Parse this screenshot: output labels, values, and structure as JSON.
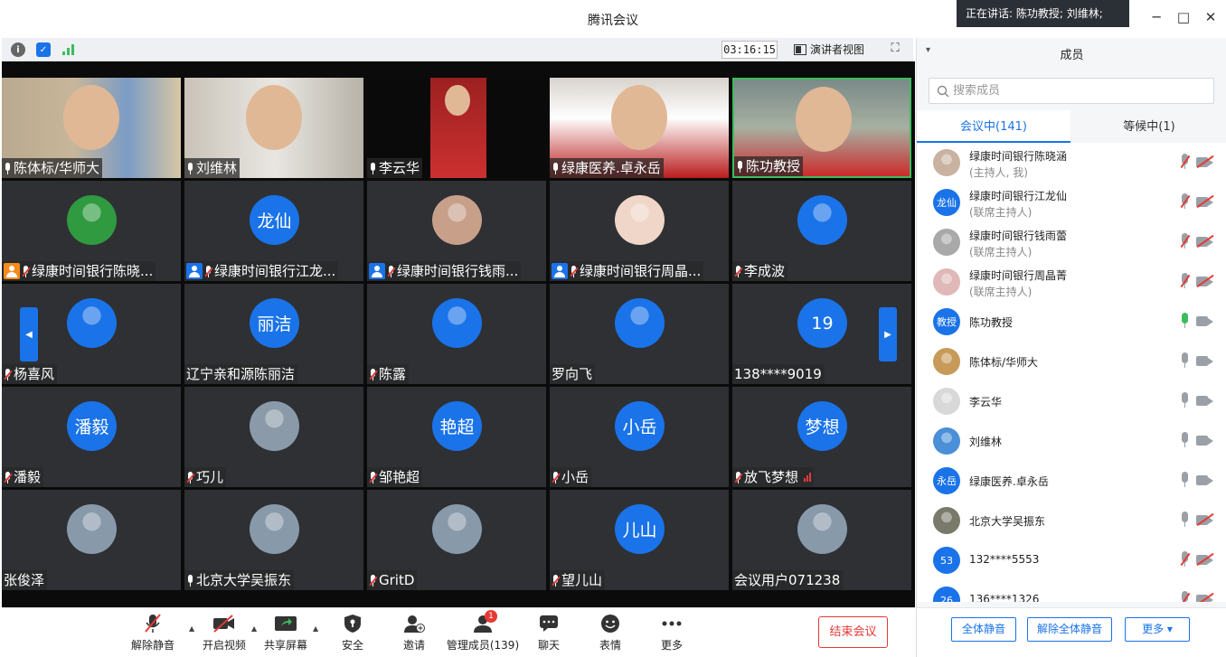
{
  "window": {
    "title": "腾讯会议",
    "speaking": "正在讲话: 陈功教授; 刘维林;",
    "minimize": "─",
    "maximize": "□",
    "close": "✕"
  },
  "topbar": {
    "timer": "03:16:15",
    "view_label": "演讲者视图",
    "icons": [
      "info-icon",
      "shield-icon",
      "signal-icon",
      "fullscreen-icon"
    ]
  },
  "accent": "#1a73e8",
  "grid": [
    {
      "name": "陈体标/华师大",
      "type": "video",
      "mic": "on"
    },
    {
      "name": "刘维林",
      "type": "video",
      "mic": "on"
    },
    {
      "name": "李云华",
      "type": "video",
      "mic": "on"
    },
    {
      "name": "绿康医养.卓永岳",
      "type": "video",
      "mic": "on"
    },
    {
      "name": "陈功教授",
      "type": "video",
      "mic": "on",
      "active": true
    },
    {
      "name": "绿康时间银行陈晓...",
      "type": "photo",
      "mic": "muted",
      "host": "orange"
    },
    {
      "name": "绿康时间银行江龙...",
      "type": "text",
      "avatar": "龙仙",
      "mic": "muted",
      "host": "blue"
    },
    {
      "name": "绿康时间银行钱雨...",
      "type": "photo",
      "mic": "muted",
      "host": "blue"
    },
    {
      "name": "绿康时间银行周晶...",
      "type": "photo",
      "mic": "muted",
      "host": "blue"
    },
    {
      "name": "李成波",
      "type": "photo",
      "mic": "muted"
    },
    {
      "name": "杨喜风",
      "type": "photo",
      "mic": "muted"
    },
    {
      "name": "辽宁亲和源陈丽洁",
      "type": "text",
      "avatar": "丽洁",
      "mic": "none"
    },
    {
      "name": "陈露",
      "type": "photo",
      "mic": "muted"
    },
    {
      "name": "罗向飞",
      "type": "photo",
      "mic": "none"
    },
    {
      "name": "138****9019",
      "type": "text",
      "avatar": "19",
      "mic": "none"
    },
    {
      "name": "潘毅",
      "type": "text",
      "avatar": "潘毅",
      "mic": "muted"
    },
    {
      "name": "巧儿",
      "type": "photo",
      "mic": "muted"
    },
    {
      "name": "邹艳超",
      "type": "text",
      "avatar": "艳超",
      "mic": "muted"
    },
    {
      "name": "小岳",
      "type": "text",
      "avatar": "小岳",
      "mic": "muted"
    },
    {
      "name": "放飞梦想",
      "type": "text",
      "avatar": "梦想",
      "mic": "muted",
      "signal": true
    },
    {
      "name": "张俊泽",
      "type": "photo",
      "mic": "none"
    },
    {
      "name": "北京大学吴振东",
      "type": "photo",
      "mic": "on"
    },
    {
      "name": "GritD",
      "type": "photo",
      "mic": "muted"
    },
    {
      "name": "望儿山",
      "type": "text",
      "avatar": "儿山",
      "mic": "muted"
    },
    {
      "name": "会议用户071238",
      "type": "photo",
      "mic": "none"
    }
  ],
  "toolbar": {
    "unmute": "解除静音",
    "video": "开启视频",
    "share": "共享屏幕",
    "security": "安全",
    "invite": "邀请",
    "manage": "管理成员(139)",
    "manage_badge": "1",
    "chat": "聊天",
    "emoji": "表情",
    "more": "更多",
    "end": "结束会议"
  },
  "panel": {
    "title": "成员",
    "search_placeholder": "搜索成员",
    "tab_in": "会议中(141)",
    "tab_wait": "等候中(1)",
    "members": [
      {
        "name": "绿康时间银行陈晓涵",
        "role": "(主持人, 我)",
        "avatar": "",
        "mic": "muted",
        "cam": "off"
      },
      {
        "name": "绿康时间银行江龙仙",
        "role": "(联席主持人)",
        "avatar": "龙仙",
        "mic": "muted",
        "cam": "off"
      },
      {
        "name": "绿康时间银行钱雨蕾",
        "role": "(联席主持人)",
        "avatar": "",
        "mic": "muted",
        "cam": "off"
      },
      {
        "name": "绿康时间银行周晶菁",
        "role": "(联席主持人)",
        "avatar": "",
        "mic": "muted",
        "cam": "off"
      },
      {
        "name": "陈功教授",
        "role": "",
        "avatar": "教授",
        "mic": "active",
        "cam": "on"
      },
      {
        "name": "陈体标/华师大",
        "role": "",
        "avatar": "",
        "mic": "on",
        "cam": "on"
      },
      {
        "name": "李云华",
        "role": "",
        "avatar": "",
        "mic": "on",
        "cam": "on"
      },
      {
        "name": "刘维林",
        "role": "",
        "avatar": "",
        "mic": "on",
        "cam": "on"
      },
      {
        "name": "绿康医养.卓永岳",
        "role": "",
        "avatar": "永岳",
        "mic": "on",
        "cam": "on"
      },
      {
        "name": "北京大学吴振东",
        "role": "",
        "avatar": "",
        "mic": "on",
        "cam": "off"
      },
      {
        "name": "132****5553",
        "role": "",
        "avatar": "53",
        "mic": "muted",
        "cam": "off"
      },
      {
        "name": "136****1326",
        "role": "",
        "avatar": "26",
        "mic": "muted",
        "cam": "off"
      }
    ],
    "mute_all": "全体静音",
    "unmute_all": "解除全体静音",
    "more": "更多 ▾"
  }
}
